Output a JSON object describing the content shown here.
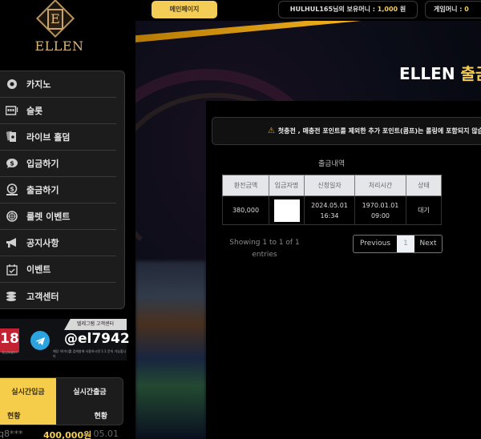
{
  "brand": {
    "logo_letter": "E",
    "logo_text": "ELLEN"
  },
  "topbar": {
    "main_page_button": "메인페이지",
    "balance_prefix": "HULHUL165님의 보유머니 : ",
    "balance_value": "1,000",
    "balance_suffix": " 원",
    "game_money_prefix": "게임머니 : ",
    "game_money_value": "0"
  },
  "sidebar": {
    "items": [
      {
        "label": "카지노",
        "icon": "casino-chip-icon"
      },
      {
        "label": "슬롯",
        "icon": "slot-machine-icon"
      },
      {
        "label": "라이브 홀덤",
        "icon": "playing-cards-icon"
      },
      {
        "label": "입금하기",
        "icon": "deposit-icon"
      },
      {
        "label": "출금하기",
        "icon": "withdraw-icon"
      },
      {
        "label": "룰렛 이벤트",
        "icon": "roulette-icon"
      },
      {
        "label": "공지사항",
        "icon": "megaphone-icon"
      },
      {
        "label": "이벤트",
        "icon": "calendar-check-icon"
      },
      {
        "label": "고객센터",
        "icon": "coins-stack-icon"
      }
    ]
  },
  "telegram": {
    "tab_label": "텔레그램 고객센터",
    "age_badge": "18",
    "age_sub": "청소년이용불가",
    "handle": "@el7942",
    "note": "해당 아이디를 검색창에 사용하시면 1:1 문의 가능합니다"
  },
  "live": {
    "tabs": [
      {
        "line1": "실시간입금",
        "line2": "현황",
        "active": true
      },
      {
        "line1": "실시간출금",
        "line2": "현황",
        "active": false
      }
    ],
    "rows": [
      {
        "user": "q8***",
        "amount": "400,000원",
        "date": "05.01"
      }
    ]
  },
  "hero": {
    "title_main": "ELLEN ",
    "title_accent": "출금"
  },
  "notice": {
    "text": "첫충전 , 매충전 포인트를 제외한 추가 포인트(콤프)는 롤링에 포함되지 않습니다"
  },
  "history": {
    "title": "출금내역",
    "columns": [
      "환전금액",
      "입금자명",
      "신청일자",
      "처리시간",
      "상태"
    ],
    "rows": [
      {
        "amount": "380,000",
        "name": "",
        "request_date": "2024.05.01",
        "request_time": "16:34",
        "process_date": "1970.01.01",
        "process_time": "09:00",
        "status": "대기"
      }
    ],
    "showing": "Showing 1 to 1 of 1 entries",
    "pager": {
      "previous": "Previous",
      "current": "1",
      "next": "Next"
    }
  },
  "colors": {
    "accent": "#f3cd55",
    "status_wait": "#c22b2b",
    "telegram": "#2aa3df"
  }
}
